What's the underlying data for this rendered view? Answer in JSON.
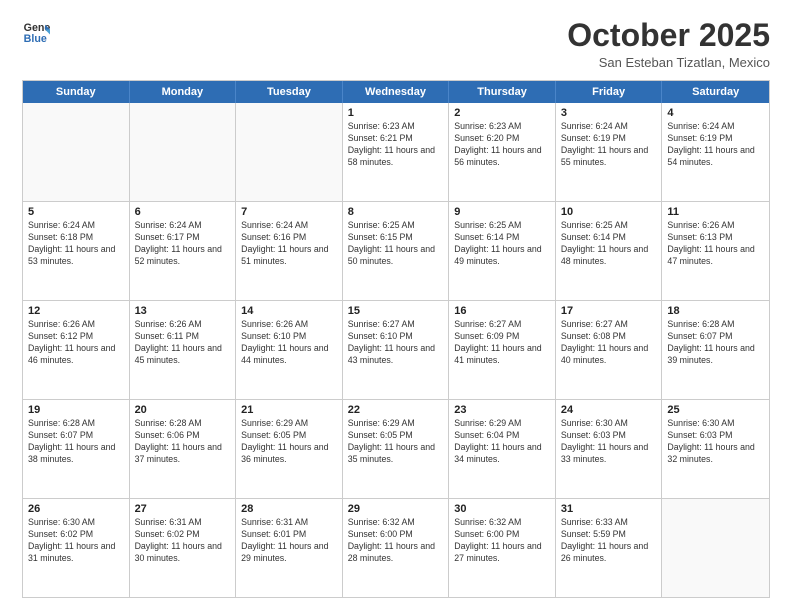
{
  "header": {
    "logo_general": "General",
    "logo_blue": "Blue",
    "month": "October 2025",
    "location": "San Esteban Tizatlan, Mexico"
  },
  "weekdays": [
    "Sunday",
    "Monday",
    "Tuesday",
    "Wednesday",
    "Thursday",
    "Friday",
    "Saturday"
  ],
  "rows": [
    [
      {
        "day": "",
        "info": ""
      },
      {
        "day": "",
        "info": ""
      },
      {
        "day": "",
        "info": ""
      },
      {
        "day": "1",
        "info": "Sunrise: 6:23 AM\nSunset: 6:21 PM\nDaylight: 11 hours and 58 minutes."
      },
      {
        "day": "2",
        "info": "Sunrise: 6:23 AM\nSunset: 6:20 PM\nDaylight: 11 hours and 56 minutes."
      },
      {
        "day": "3",
        "info": "Sunrise: 6:24 AM\nSunset: 6:19 PM\nDaylight: 11 hours and 55 minutes."
      },
      {
        "day": "4",
        "info": "Sunrise: 6:24 AM\nSunset: 6:19 PM\nDaylight: 11 hours and 54 minutes."
      }
    ],
    [
      {
        "day": "5",
        "info": "Sunrise: 6:24 AM\nSunset: 6:18 PM\nDaylight: 11 hours and 53 minutes."
      },
      {
        "day": "6",
        "info": "Sunrise: 6:24 AM\nSunset: 6:17 PM\nDaylight: 11 hours and 52 minutes."
      },
      {
        "day": "7",
        "info": "Sunrise: 6:24 AM\nSunset: 6:16 PM\nDaylight: 11 hours and 51 minutes."
      },
      {
        "day": "8",
        "info": "Sunrise: 6:25 AM\nSunset: 6:15 PM\nDaylight: 11 hours and 50 minutes."
      },
      {
        "day": "9",
        "info": "Sunrise: 6:25 AM\nSunset: 6:14 PM\nDaylight: 11 hours and 49 minutes."
      },
      {
        "day": "10",
        "info": "Sunrise: 6:25 AM\nSunset: 6:14 PM\nDaylight: 11 hours and 48 minutes."
      },
      {
        "day": "11",
        "info": "Sunrise: 6:26 AM\nSunset: 6:13 PM\nDaylight: 11 hours and 47 minutes."
      }
    ],
    [
      {
        "day": "12",
        "info": "Sunrise: 6:26 AM\nSunset: 6:12 PM\nDaylight: 11 hours and 46 minutes."
      },
      {
        "day": "13",
        "info": "Sunrise: 6:26 AM\nSunset: 6:11 PM\nDaylight: 11 hours and 45 minutes."
      },
      {
        "day": "14",
        "info": "Sunrise: 6:26 AM\nSunset: 6:10 PM\nDaylight: 11 hours and 44 minutes."
      },
      {
        "day": "15",
        "info": "Sunrise: 6:27 AM\nSunset: 6:10 PM\nDaylight: 11 hours and 43 minutes."
      },
      {
        "day": "16",
        "info": "Sunrise: 6:27 AM\nSunset: 6:09 PM\nDaylight: 11 hours and 41 minutes."
      },
      {
        "day": "17",
        "info": "Sunrise: 6:27 AM\nSunset: 6:08 PM\nDaylight: 11 hours and 40 minutes."
      },
      {
        "day": "18",
        "info": "Sunrise: 6:28 AM\nSunset: 6:07 PM\nDaylight: 11 hours and 39 minutes."
      }
    ],
    [
      {
        "day": "19",
        "info": "Sunrise: 6:28 AM\nSunset: 6:07 PM\nDaylight: 11 hours and 38 minutes."
      },
      {
        "day": "20",
        "info": "Sunrise: 6:28 AM\nSunset: 6:06 PM\nDaylight: 11 hours and 37 minutes."
      },
      {
        "day": "21",
        "info": "Sunrise: 6:29 AM\nSunset: 6:05 PM\nDaylight: 11 hours and 36 minutes."
      },
      {
        "day": "22",
        "info": "Sunrise: 6:29 AM\nSunset: 6:05 PM\nDaylight: 11 hours and 35 minutes."
      },
      {
        "day": "23",
        "info": "Sunrise: 6:29 AM\nSunset: 6:04 PM\nDaylight: 11 hours and 34 minutes."
      },
      {
        "day": "24",
        "info": "Sunrise: 6:30 AM\nSunset: 6:03 PM\nDaylight: 11 hours and 33 minutes."
      },
      {
        "day": "25",
        "info": "Sunrise: 6:30 AM\nSunset: 6:03 PM\nDaylight: 11 hours and 32 minutes."
      }
    ],
    [
      {
        "day": "26",
        "info": "Sunrise: 6:30 AM\nSunset: 6:02 PM\nDaylight: 11 hours and 31 minutes."
      },
      {
        "day": "27",
        "info": "Sunrise: 6:31 AM\nSunset: 6:02 PM\nDaylight: 11 hours and 30 minutes."
      },
      {
        "day": "28",
        "info": "Sunrise: 6:31 AM\nSunset: 6:01 PM\nDaylight: 11 hours and 29 minutes."
      },
      {
        "day": "29",
        "info": "Sunrise: 6:32 AM\nSunset: 6:00 PM\nDaylight: 11 hours and 28 minutes."
      },
      {
        "day": "30",
        "info": "Sunrise: 6:32 AM\nSunset: 6:00 PM\nDaylight: 11 hours and 27 minutes."
      },
      {
        "day": "31",
        "info": "Sunrise: 6:33 AM\nSunset: 5:59 PM\nDaylight: 11 hours and 26 minutes."
      },
      {
        "day": "",
        "info": ""
      }
    ]
  ]
}
